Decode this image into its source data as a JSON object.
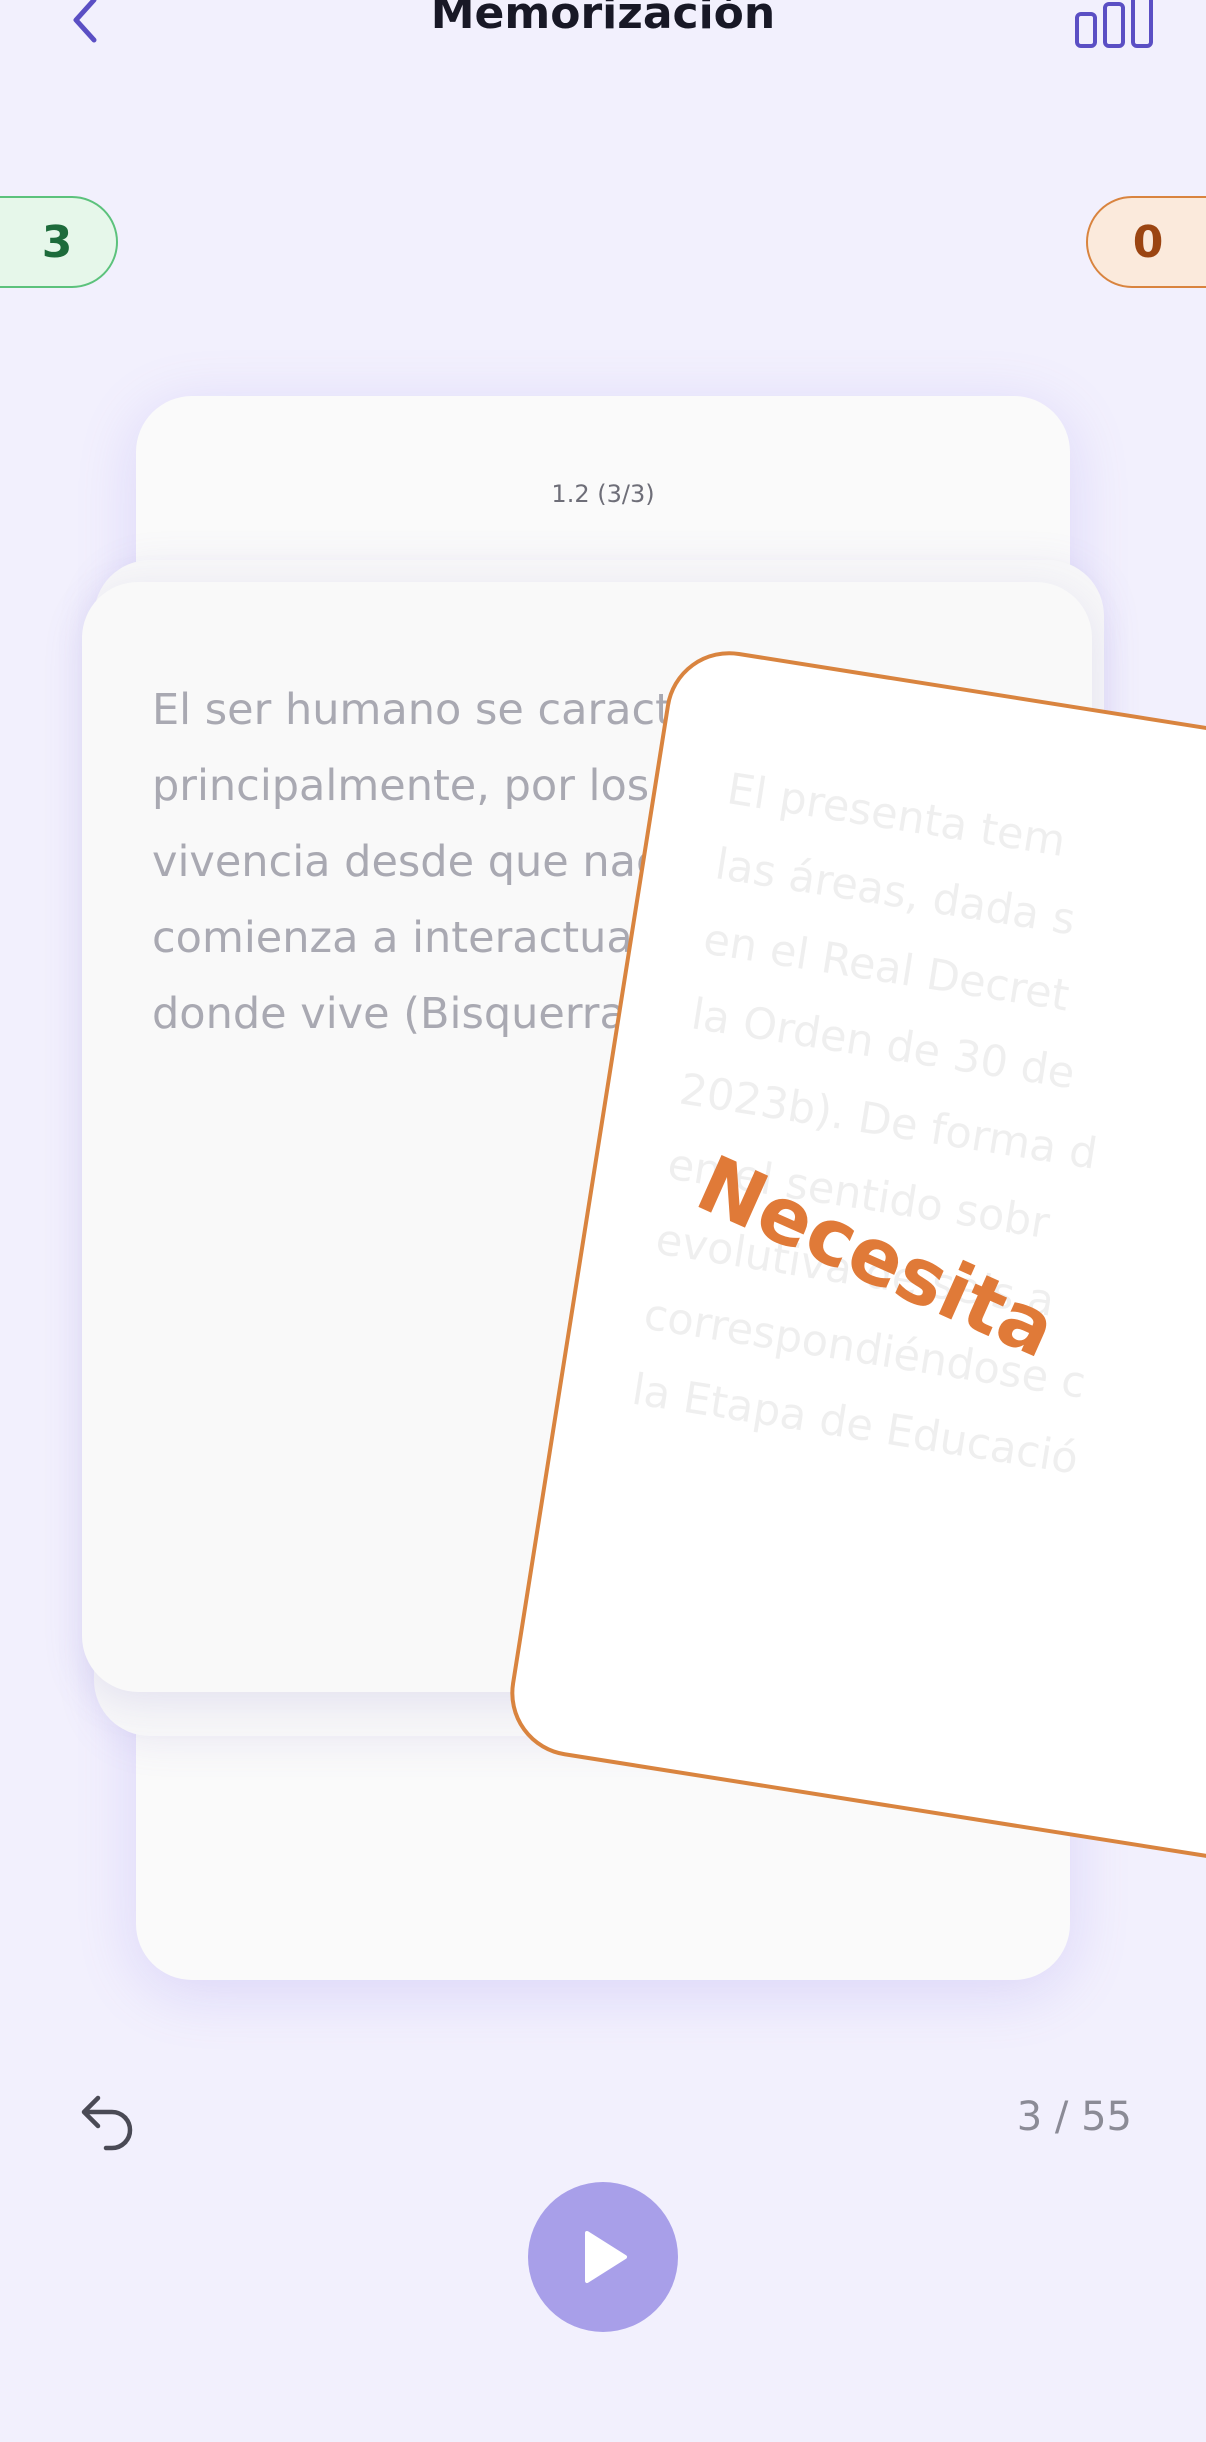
{
  "header": {
    "title": "Memorización",
    "back_icon": "chevron-left-icon",
    "stats_icon": "bar-chart-icon"
  },
  "counters": {
    "known_count": "3",
    "unknown_count": "0"
  },
  "card": {
    "reference": "1.2 (3/3)",
    "front_text": "El ser humano se caracteriza\nprincipalmente, por los camb\nvivencia desde que nace ha\ncomienza a interactuar en l\ndonde vive (Bisquerra y Pé",
    "swiped_text": "El presenta tem\nlas áreas, dada s\nen el Real Decret\nla Orden de 30 de\n2023b). De forma d\nen el sentido sobr\nevolutiva de seis a\ncorrespondiéndose c\nla Etapa de Educació",
    "swipe_label": "Necesita"
  },
  "footer": {
    "undo_icon": "undo-icon",
    "progress": "3 / 55",
    "play_icon": "play-icon"
  },
  "colors": {
    "background": "#f2f0fd",
    "accent": "#5b4fc4",
    "known": "#5cc27c",
    "unknown": "#d9843f",
    "play": "#a89fe9"
  }
}
